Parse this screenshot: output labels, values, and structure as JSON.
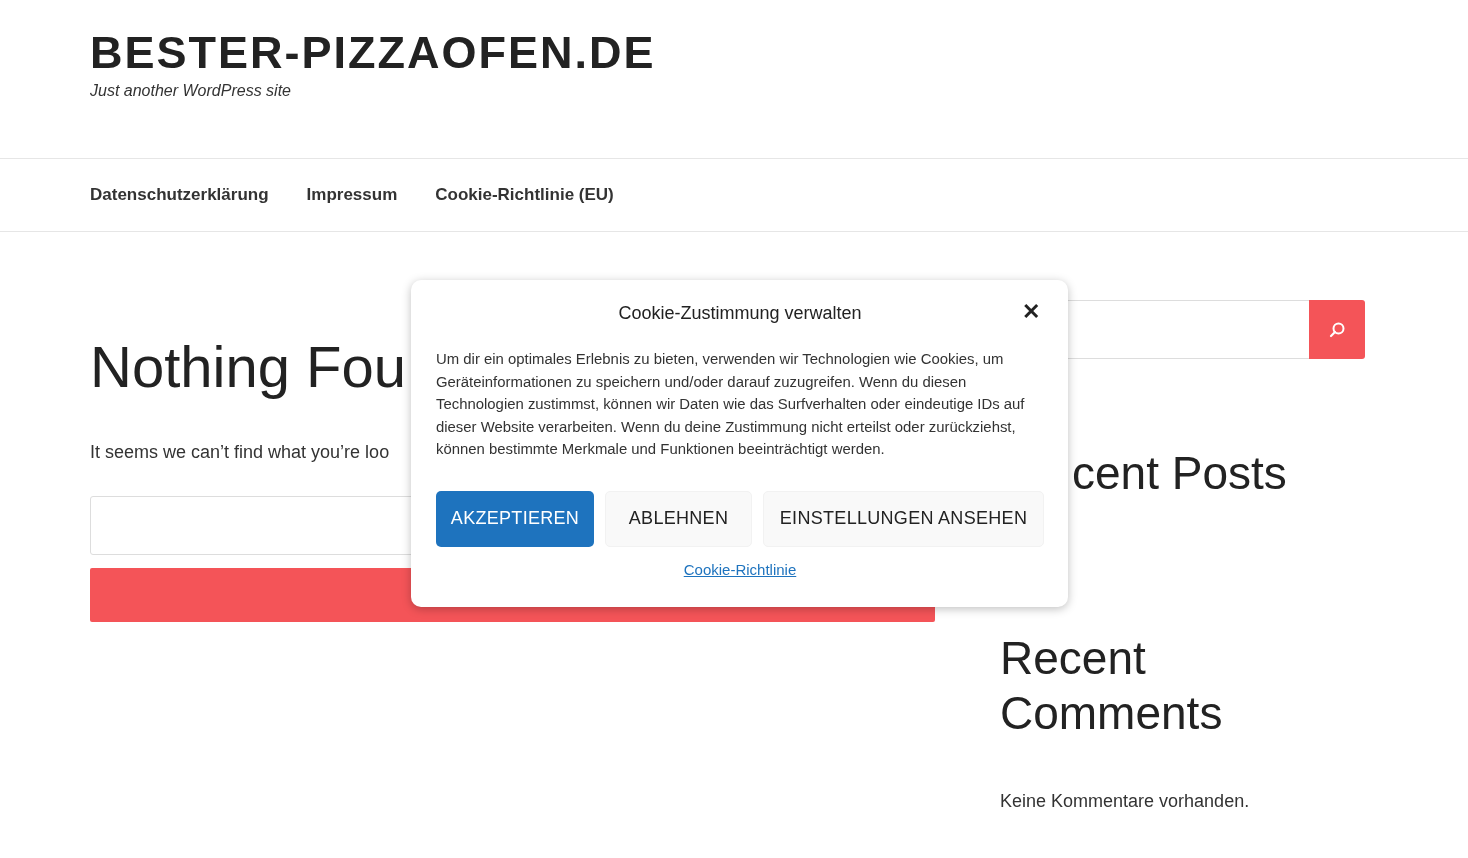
{
  "site": {
    "title": "BESTER-PIZZAOFEN.DE",
    "tagline": "Just another WordPress site"
  },
  "nav": [
    {
      "label": "Datenschutzerklärung"
    },
    {
      "label": "Impressum"
    },
    {
      "label": "Cookie-Richtlinie (EU)"
    }
  ],
  "main": {
    "heading": "Nothing Fou",
    "message": "It seems we can’t find what you’re loo"
  },
  "sidebar": {
    "recent_posts_heading": "cent Posts",
    "recent_comments_heading": "Recent Comments",
    "comments_empty": "Keine Kommentare vorhanden."
  },
  "cookie_dialog": {
    "title": "Cookie-Zustimmung verwalten",
    "close": "✕",
    "text": "Um dir ein optimales Erlebnis zu bieten, verwenden wir Technologien wie Cookies, um Geräteinformationen zu speichern und/oder darauf zuzugreifen. Wenn du diesen Technologien zustimmst, können wir Daten wie das Surfverhalten oder eindeutige IDs auf dieser Website verarbeiten. Wenn du deine Zustimmung nicht erteilst oder zurückziehst, können bestimmte Merkmale und Funktionen beeinträchtigt werden.",
    "buttons": [
      {
        "label": "AKZEPTIEREN",
        "kind": "primary"
      },
      {
        "label": "ABLEHNEN",
        "kind": "secondary"
      },
      {
        "label": "EINSTELLUNGEN ANSEHEN",
        "kind": "secondary"
      }
    ],
    "link": "Cookie-Richtlinie"
  }
}
